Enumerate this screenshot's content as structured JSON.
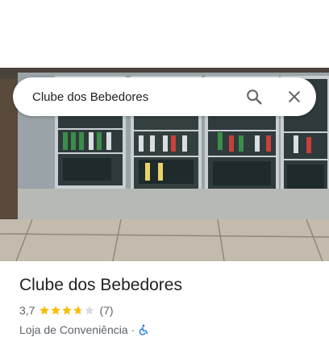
{
  "search": {
    "value": "Clube dos Bebedores",
    "search_icon": "search-icon",
    "close_icon": "close-icon"
  },
  "photo": {
    "alt": "Geladeiras com bebidas"
  },
  "place": {
    "name": "Clube dos Bebedores",
    "rating": "3,7",
    "rating_value": 3.7,
    "rating_max": 5,
    "review_count": "(7)",
    "category": "Loja de Conveniência",
    "separator": "·",
    "accessibility_icon": "wheelchair-icon"
  },
  "colors": {
    "star_filled": "#fbbc04",
    "star_empty": "#dadce0",
    "accessibility": "#1a73e8",
    "text_primary": "#202124",
    "text_secondary": "#5f6368"
  }
}
